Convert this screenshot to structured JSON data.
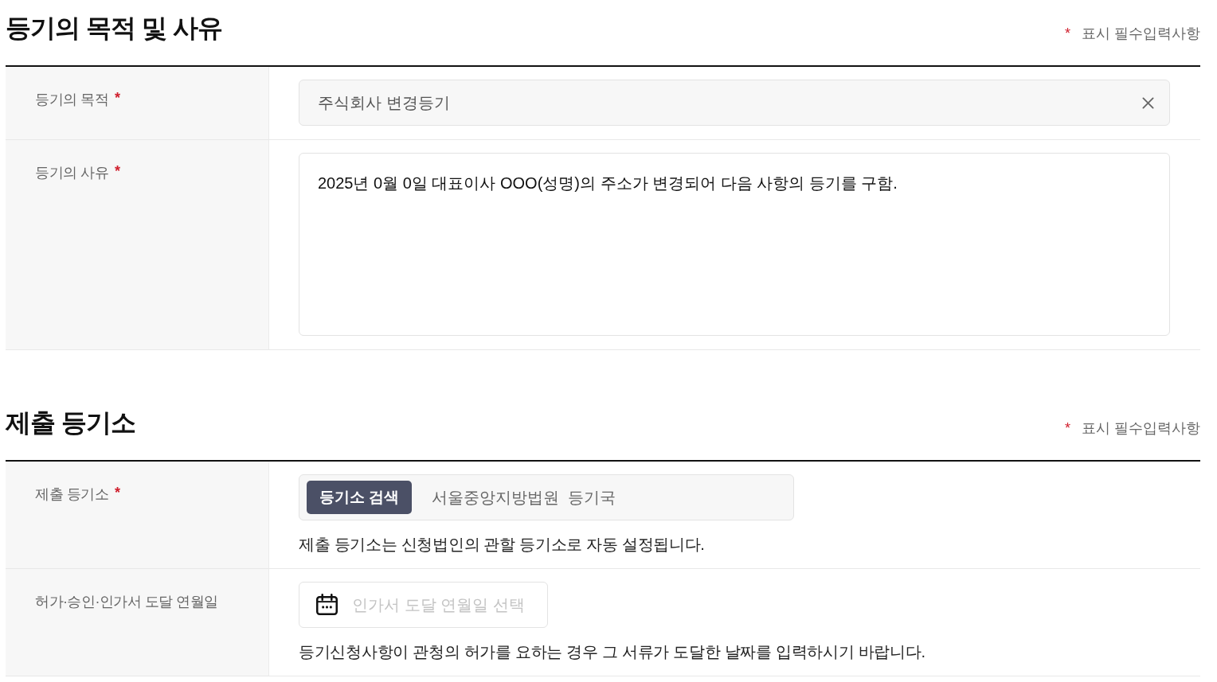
{
  "sections": [
    {
      "title": "등기의 목적 및 사유",
      "legend_mark": "*",
      "legend_text": "표시 필수입력사항",
      "rows": [
        {
          "kind": "select",
          "label": "등기의 목적",
          "mark": "*",
          "value": "주식회사 변경등기"
        },
        {
          "kind": "textarea",
          "label": "등기의 사유",
          "mark": "*",
          "value": "2025년 0월 0일 대표이사 OOO(성명)의 주소가 변경되어 다음 사항의 등기를 구함."
        }
      ]
    },
    {
      "title": "제출 등기소",
      "legend_mark": "*",
      "legend_text": "표시 필수입력사항",
      "rows": [
        {
          "kind": "search",
          "label": "제출 등기소",
          "mark": "*",
          "button": "등기소 검색",
          "value": "서울중앙지방법원  등기국",
          "help": "제출 등기소는 신청법인의 관할 등기소로 자동 설정됩니다."
        },
        {
          "kind": "date",
          "label": "허가·승인·인가서 도달 연월일",
          "placeholder": "인가서 도달 연월일 선택",
          "help": "등기신청사항이 관청의 허가를 요하는 경우 그 서류가 도달한 날짜를 입력하시기 바랍니다."
        }
      ]
    }
  ]
}
